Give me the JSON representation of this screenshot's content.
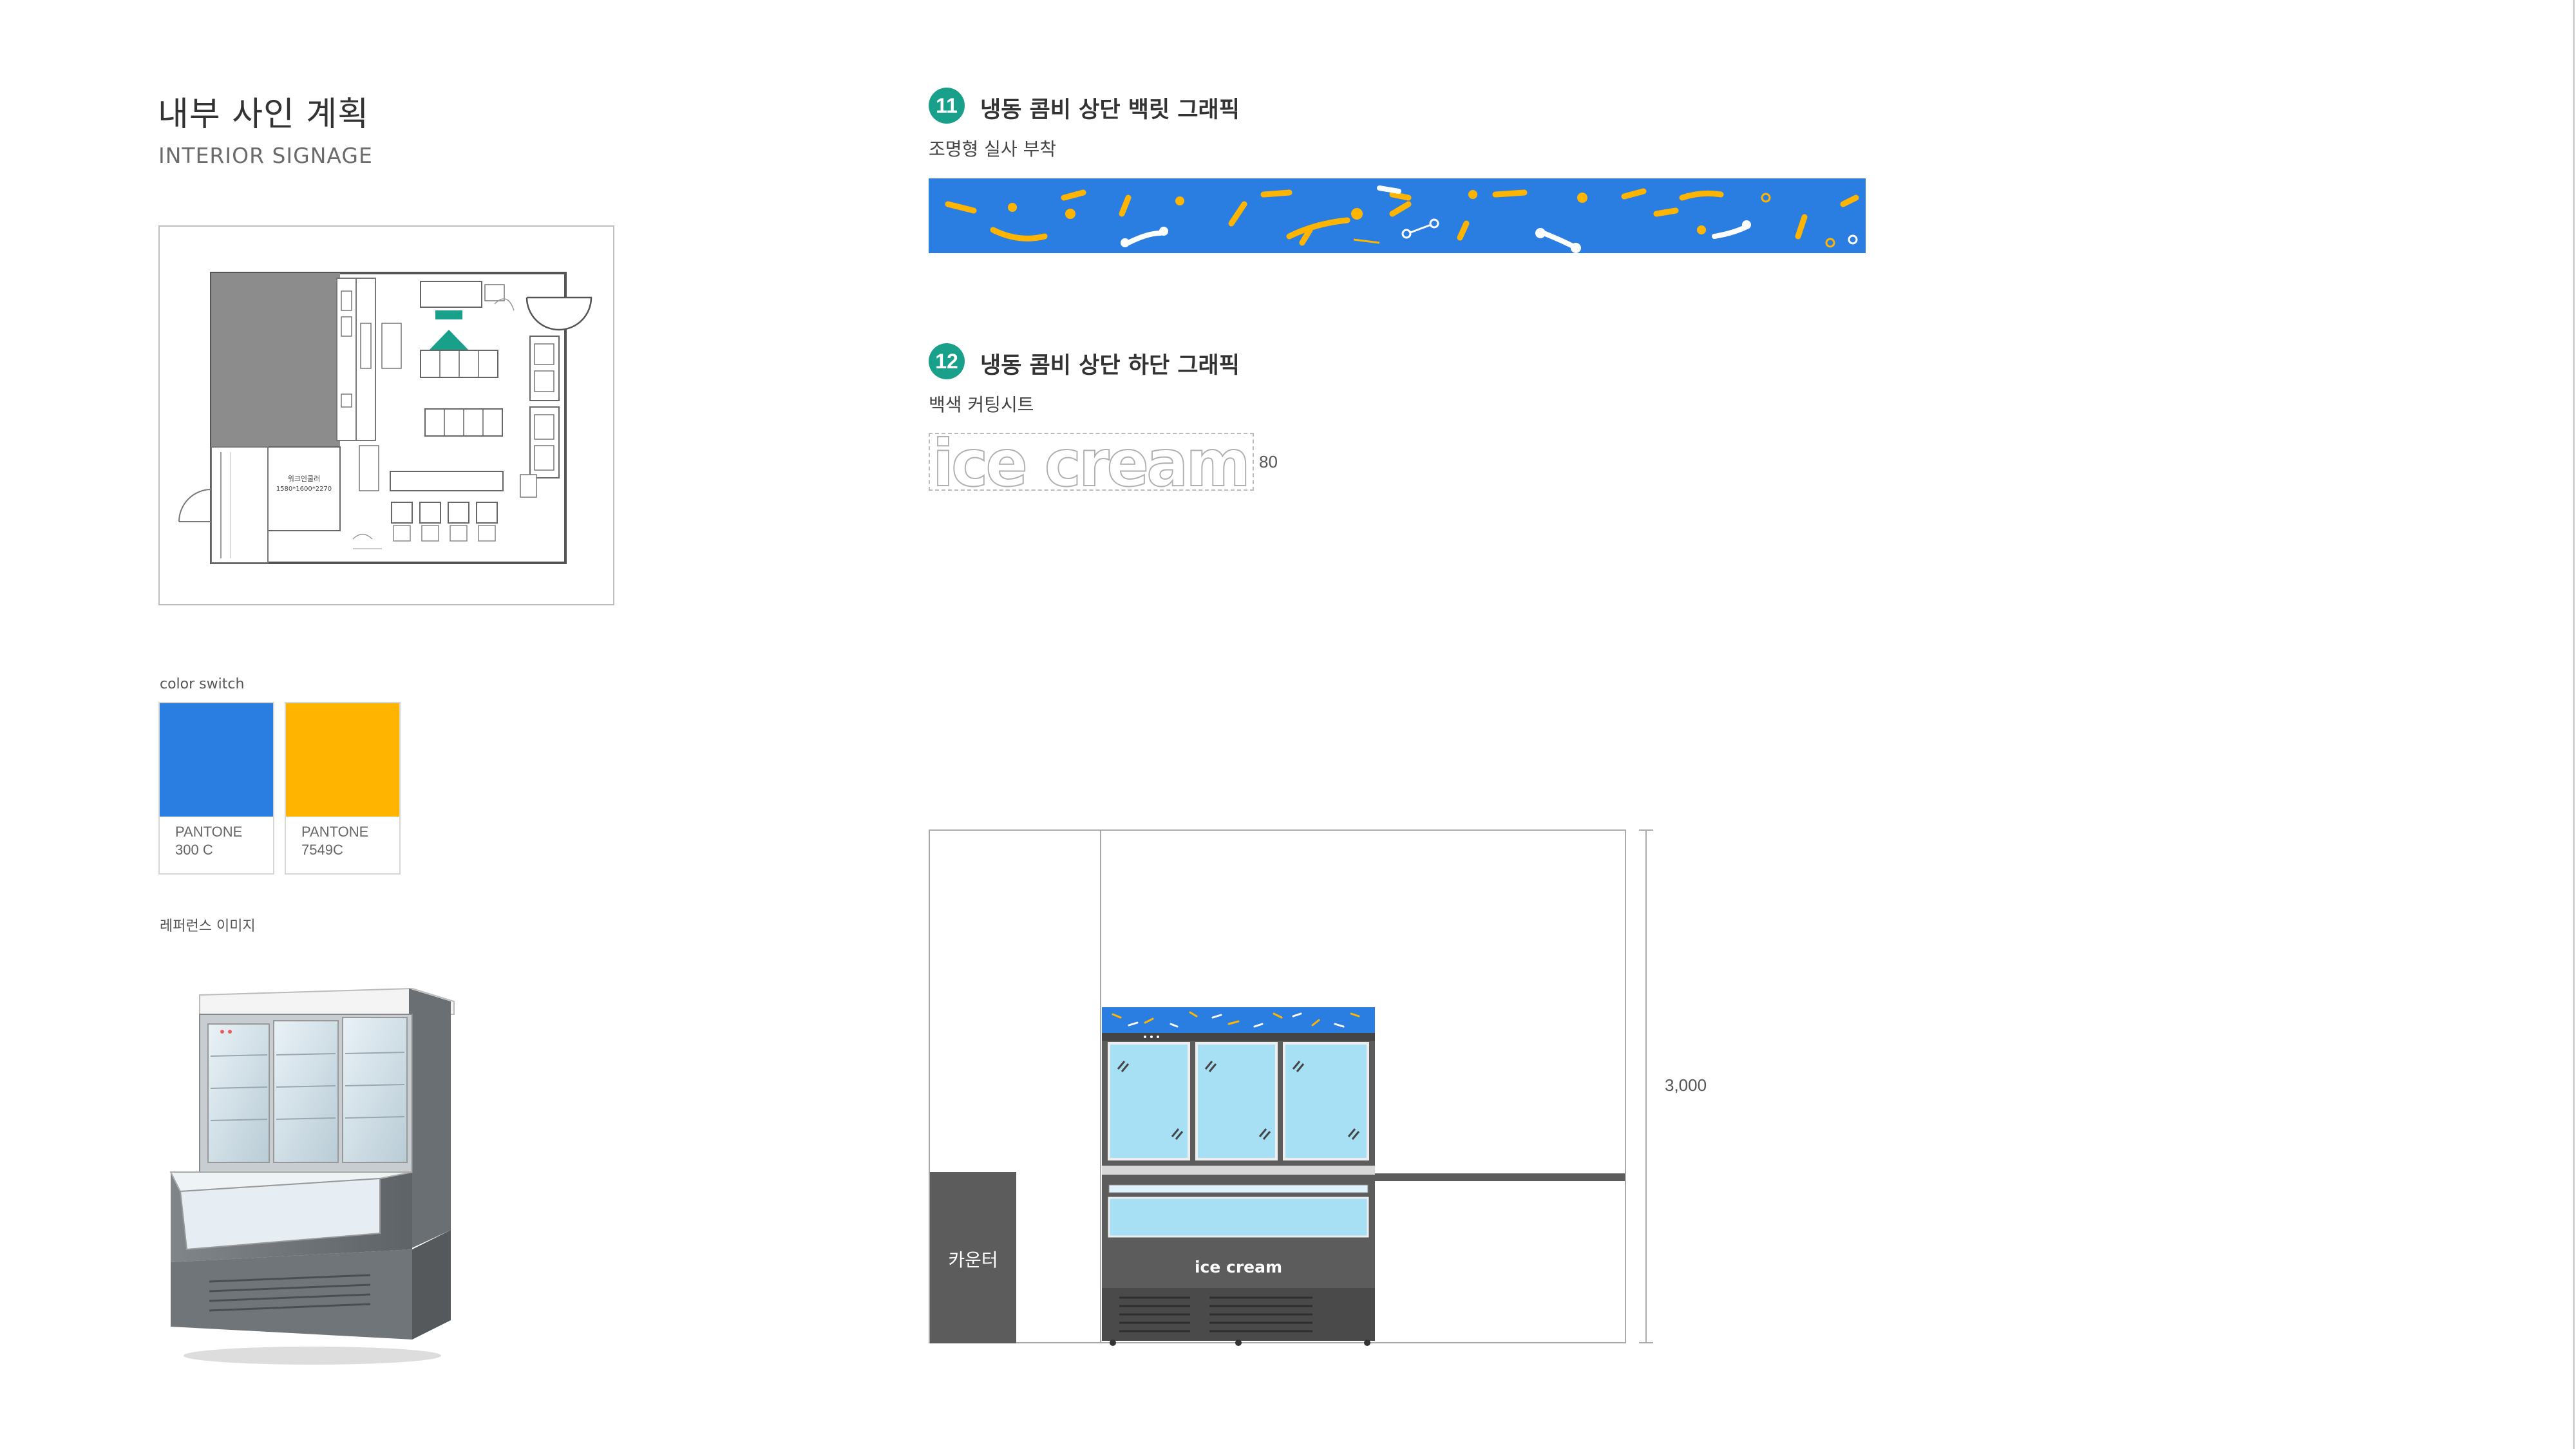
{
  "header": {
    "title_ko": "내부 사인 계획",
    "title_en": "INTERIOR SIGNAGE"
  },
  "floor_plan": {
    "walkin_label": "워크인쿨러",
    "walkin_dims": "1580*1600*2270"
  },
  "color_switch": {
    "label": "color switch",
    "swatches": [
      {
        "pantone": "PANTONE",
        "code": "300 C",
        "hex": "#2a7de1"
      },
      {
        "pantone": "PANTONE",
        "code": "7549C",
        "hex": "#ffb500"
      }
    ]
  },
  "reference": {
    "label": "레퍼런스 이미지"
  },
  "sections": [
    {
      "number": "11",
      "title": "냉동 콤비 상단 백릿 그래픽",
      "subtitle": "조명형 실사 부착"
    },
    {
      "number": "12",
      "title": "냉동 콤비 상단 하단 그래픽",
      "subtitle": "백색 커팅시트"
    }
  ],
  "graphic": {
    "text": "ice cream",
    "height_dim": "80"
  },
  "elevation": {
    "counter_label": "카운터",
    "height_dim": "3,000",
    "freezer_text": "ice cream"
  },
  "colors": {
    "accent": "#19a08a",
    "blue": "#2a7de1",
    "yellow": "#ffb500",
    "gray": "#5c5c5c"
  }
}
